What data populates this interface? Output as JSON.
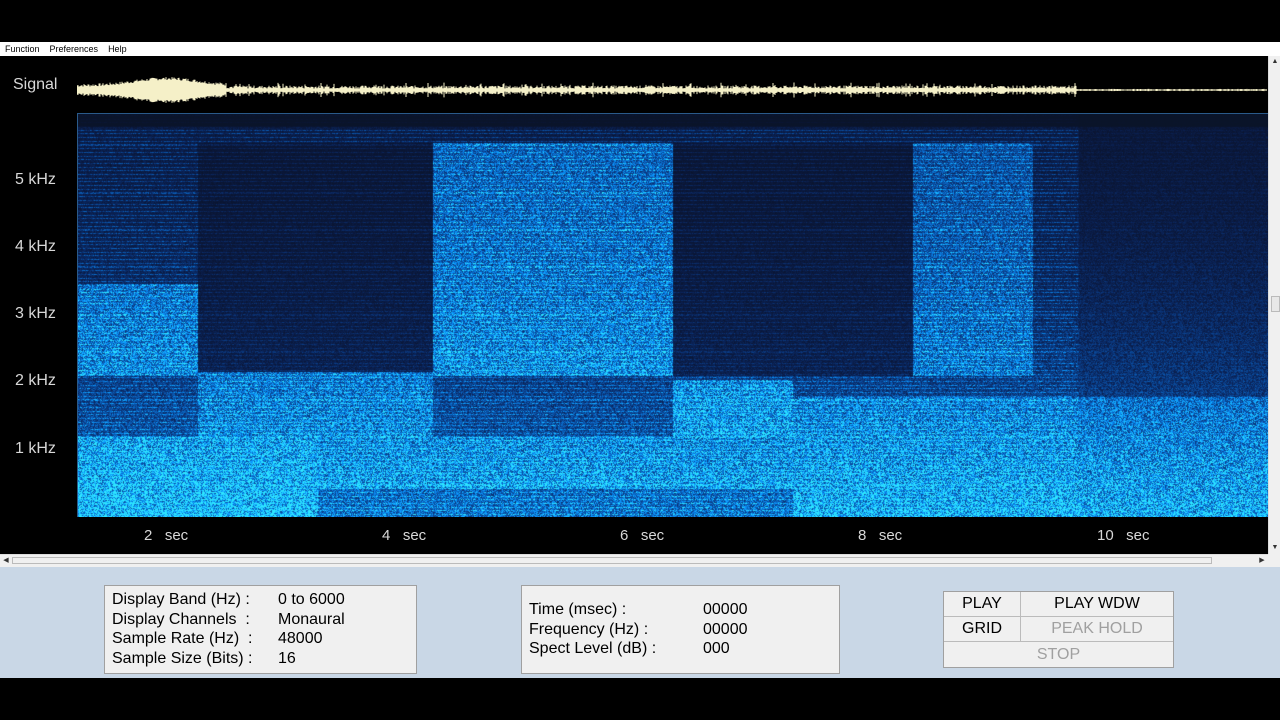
{
  "menu": {
    "items": [
      "Function",
      "Preferences",
      "Help"
    ]
  },
  "display": {
    "signal_label": "Signal",
    "freq_labels": [
      "5 kHz",
      "4 kHz",
      "3 kHz",
      "2 kHz",
      "1 kHz"
    ],
    "time_labels": [
      "2   sec",
      "4   sec",
      "6   sec",
      "8   sec",
      "10   sec"
    ]
  },
  "settings_panel": {
    "display_band_label": "Display Band (Hz) :",
    "display_band_value": "0 to 6000",
    "display_channels_label": "Display Channels  :",
    "display_channels_value": "Monaural",
    "sample_rate_label": "Sample Rate (Hz)  :",
    "sample_rate_value": "48000",
    "sample_size_label": "Sample Size (Bits) :",
    "sample_size_value": "16"
  },
  "readout_panel": {
    "time_label": "Time (msec) :",
    "time_value": "00000",
    "frequency_label": "Frequency (Hz) :",
    "frequency_value": "00000",
    "spect_level_label": "Spect Level (dB) :",
    "spect_level_value": "000"
  },
  "buttons": {
    "play": "PLAY",
    "play_wdw": "PLAY WDW",
    "grid": "GRID",
    "peak_hold": "PEAK HOLD",
    "stop": "STOP"
  },
  "colors": {
    "waveform": "#f5f0c8",
    "spectrogram_low": "#061a4a",
    "spectrogram_mid": "#1560c8",
    "spectrogram_high": "#30d8ff",
    "panel_background": "#c9d7e6"
  },
  "icons": {
    "scroll_up": "triangle-up-icon",
    "scroll_down": "triangle-down-icon",
    "scroll_left": "triangle-left-icon",
    "scroll_right": "triangle-right-icon"
  }
}
